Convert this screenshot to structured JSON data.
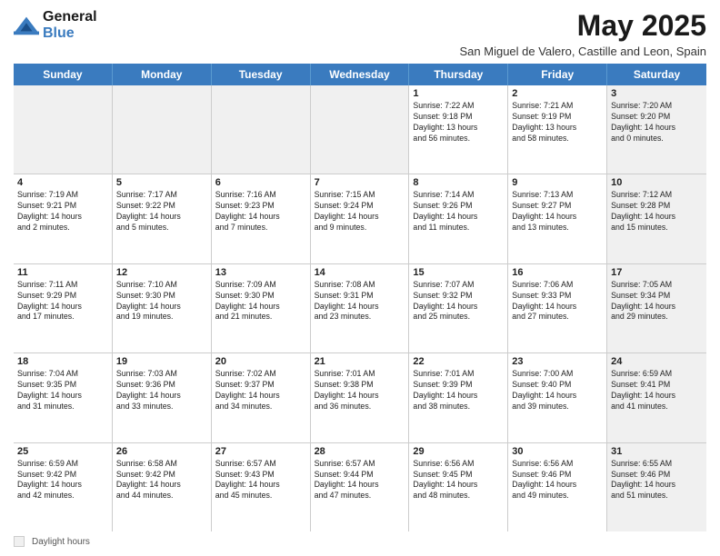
{
  "header": {
    "logo": {
      "line1": "General",
      "line2": "Blue"
    },
    "title": "May 2025",
    "location": "San Miguel de Valero, Castille and Leon, Spain"
  },
  "weekdays": [
    "Sunday",
    "Monday",
    "Tuesday",
    "Wednesday",
    "Thursday",
    "Friday",
    "Saturday"
  ],
  "rows": [
    {
      "cells": [
        {
          "day": "",
          "shaded": true,
          "info": ""
        },
        {
          "day": "",
          "shaded": true,
          "info": ""
        },
        {
          "day": "",
          "shaded": true,
          "info": ""
        },
        {
          "day": "",
          "shaded": true,
          "info": ""
        },
        {
          "day": "1",
          "shaded": false,
          "info": "Sunrise: 7:22 AM\nSunset: 9:18 PM\nDaylight: 13 hours\nand 56 minutes."
        },
        {
          "day": "2",
          "shaded": false,
          "info": "Sunrise: 7:21 AM\nSunset: 9:19 PM\nDaylight: 13 hours\nand 58 minutes."
        },
        {
          "day": "3",
          "shaded": true,
          "info": "Sunrise: 7:20 AM\nSunset: 9:20 PM\nDaylight: 14 hours\nand 0 minutes."
        }
      ]
    },
    {
      "cells": [
        {
          "day": "4",
          "shaded": false,
          "info": "Sunrise: 7:19 AM\nSunset: 9:21 PM\nDaylight: 14 hours\nand 2 minutes."
        },
        {
          "day": "5",
          "shaded": false,
          "info": "Sunrise: 7:17 AM\nSunset: 9:22 PM\nDaylight: 14 hours\nand 5 minutes."
        },
        {
          "day": "6",
          "shaded": false,
          "info": "Sunrise: 7:16 AM\nSunset: 9:23 PM\nDaylight: 14 hours\nand 7 minutes."
        },
        {
          "day": "7",
          "shaded": false,
          "info": "Sunrise: 7:15 AM\nSunset: 9:24 PM\nDaylight: 14 hours\nand 9 minutes."
        },
        {
          "day": "8",
          "shaded": false,
          "info": "Sunrise: 7:14 AM\nSunset: 9:26 PM\nDaylight: 14 hours\nand 11 minutes."
        },
        {
          "day": "9",
          "shaded": false,
          "info": "Sunrise: 7:13 AM\nSunset: 9:27 PM\nDaylight: 14 hours\nand 13 minutes."
        },
        {
          "day": "10",
          "shaded": true,
          "info": "Sunrise: 7:12 AM\nSunset: 9:28 PM\nDaylight: 14 hours\nand 15 minutes."
        }
      ]
    },
    {
      "cells": [
        {
          "day": "11",
          "shaded": false,
          "info": "Sunrise: 7:11 AM\nSunset: 9:29 PM\nDaylight: 14 hours\nand 17 minutes."
        },
        {
          "day": "12",
          "shaded": false,
          "info": "Sunrise: 7:10 AM\nSunset: 9:30 PM\nDaylight: 14 hours\nand 19 minutes."
        },
        {
          "day": "13",
          "shaded": false,
          "info": "Sunrise: 7:09 AM\nSunset: 9:30 PM\nDaylight: 14 hours\nand 21 minutes."
        },
        {
          "day": "14",
          "shaded": false,
          "info": "Sunrise: 7:08 AM\nSunset: 9:31 PM\nDaylight: 14 hours\nand 23 minutes."
        },
        {
          "day": "15",
          "shaded": false,
          "info": "Sunrise: 7:07 AM\nSunset: 9:32 PM\nDaylight: 14 hours\nand 25 minutes."
        },
        {
          "day": "16",
          "shaded": false,
          "info": "Sunrise: 7:06 AM\nSunset: 9:33 PM\nDaylight: 14 hours\nand 27 minutes."
        },
        {
          "day": "17",
          "shaded": true,
          "info": "Sunrise: 7:05 AM\nSunset: 9:34 PM\nDaylight: 14 hours\nand 29 minutes."
        }
      ]
    },
    {
      "cells": [
        {
          "day": "18",
          "shaded": false,
          "info": "Sunrise: 7:04 AM\nSunset: 9:35 PM\nDaylight: 14 hours\nand 31 minutes."
        },
        {
          "day": "19",
          "shaded": false,
          "info": "Sunrise: 7:03 AM\nSunset: 9:36 PM\nDaylight: 14 hours\nand 33 minutes."
        },
        {
          "day": "20",
          "shaded": false,
          "info": "Sunrise: 7:02 AM\nSunset: 9:37 PM\nDaylight: 14 hours\nand 34 minutes."
        },
        {
          "day": "21",
          "shaded": false,
          "info": "Sunrise: 7:01 AM\nSunset: 9:38 PM\nDaylight: 14 hours\nand 36 minutes."
        },
        {
          "day": "22",
          "shaded": false,
          "info": "Sunrise: 7:01 AM\nSunset: 9:39 PM\nDaylight: 14 hours\nand 38 minutes."
        },
        {
          "day": "23",
          "shaded": false,
          "info": "Sunrise: 7:00 AM\nSunset: 9:40 PM\nDaylight: 14 hours\nand 39 minutes."
        },
        {
          "day": "24",
          "shaded": true,
          "info": "Sunrise: 6:59 AM\nSunset: 9:41 PM\nDaylight: 14 hours\nand 41 minutes."
        }
      ]
    },
    {
      "cells": [
        {
          "day": "25",
          "shaded": false,
          "info": "Sunrise: 6:59 AM\nSunset: 9:42 PM\nDaylight: 14 hours\nand 42 minutes."
        },
        {
          "day": "26",
          "shaded": false,
          "info": "Sunrise: 6:58 AM\nSunset: 9:42 PM\nDaylight: 14 hours\nand 44 minutes."
        },
        {
          "day": "27",
          "shaded": false,
          "info": "Sunrise: 6:57 AM\nSunset: 9:43 PM\nDaylight: 14 hours\nand 45 minutes."
        },
        {
          "day": "28",
          "shaded": false,
          "info": "Sunrise: 6:57 AM\nSunset: 9:44 PM\nDaylight: 14 hours\nand 47 minutes."
        },
        {
          "day": "29",
          "shaded": false,
          "info": "Sunrise: 6:56 AM\nSunset: 9:45 PM\nDaylight: 14 hours\nand 48 minutes."
        },
        {
          "day": "30",
          "shaded": false,
          "info": "Sunrise: 6:56 AM\nSunset: 9:46 PM\nDaylight: 14 hours\nand 49 minutes."
        },
        {
          "day": "31",
          "shaded": true,
          "info": "Sunrise: 6:55 AM\nSunset: 9:46 PM\nDaylight: 14 hours\nand 51 minutes."
        }
      ]
    }
  ],
  "legend": {
    "box_label": "Daylight hours"
  }
}
